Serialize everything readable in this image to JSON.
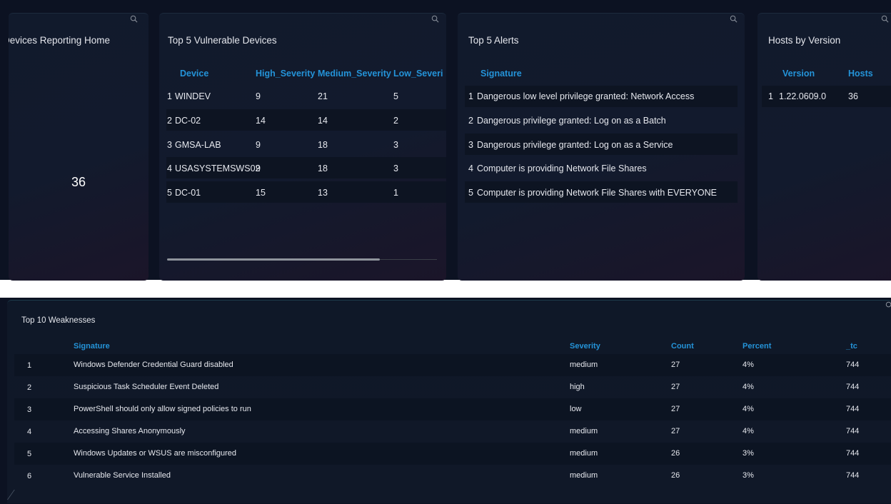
{
  "devices_reporting": {
    "title": "Devices Reporting Home",
    "value": "36"
  },
  "vulnerable_devices": {
    "title": "Top 5 Vulnerable Devices",
    "columns": [
      "Device",
      "High_Severity",
      "Medium_Severity",
      "Low_Severi"
    ],
    "rows": [
      {
        "rank": "1",
        "device": "WINDEV",
        "high": "9",
        "medium": "21",
        "low": "5"
      },
      {
        "rank": "2",
        "device": "DC-02",
        "high": "14",
        "medium": "14",
        "low": "2"
      },
      {
        "rank": "3",
        "device": "GMSA-LAB",
        "high": "9",
        "medium": "18",
        "low": "3"
      },
      {
        "rank": "4",
        "device": "USASYSTEMSWS02",
        "high": "9",
        "medium": "18",
        "low": "3"
      },
      {
        "rank": "5",
        "device": "DC-01",
        "high": "15",
        "medium": "13",
        "low": "1"
      }
    ]
  },
  "alerts": {
    "title": "Top 5 Alerts",
    "column": "Signature",
    "rows": [
      {
        "rank": "1",
        "signature": "Dangerous low level privilege granted: Network Access"
      },
      {
        "rank": "2",
        "signature": "Dangerous privilege granted: Log on as a Batch"
      },
      {
        "rank": "3",
        "signature": "Dangerous privilege granted: Log on as a Service"
      },
      {
        "rank": "4",
        "signature": "Computer is providing Network File Shares"
      },
      {
        "rank": "5",
        "signature": "Computer is providing Network File Shares with EVERYONE"
      }
    ]
  },
  "hosts_by_version": {
    "title": "Hosts by Version",
    "columns": [
      "Version",
      "Hosts"
    ],
    "rows": [
      {
        "rank": "1",
        "version": "1.22.0609.0",
        "hosts": "36"
      }
    ]
  },
  "weaknesses": {
    "title": "Top 10 Weaknesses",
    "columns": [
      "Signature",
      "Severity",
      "Count",
      "Percent",
      "_tc"
    ],
    "rows": [
      {
        "rank": "1",
        "signature": "Windows Defender Credential Guard disabled",
        "severity": "medium",
        "count": "27",
        "percent": "4%",
        "tc": "744"
      },
      {
        "rank": "2",
        "signature": "Suspicious Task Scheduler Event Deleted",
        "severity": "high",
        "count": "27",
        "percent": "4%",
        "tc": "744"
      },
      {
        "rank": "3",
        "signature": "PowerShell should only allow signed policies to run",
        "severity": "low",
        "count": "27",
        "percent": "4%",
        "tc": "744"
      },
      {
        "rank": "4",
        "signature": "Accessing Shares Anonymously",
        "severity": "medium",
        "count": "27",
        "percent": "4%",
        "tc": "744"
      },
      {
        "rank": "5",
        "signature": "Windows Updates or WSUS are misconfigured",
        "severity": "medium",
        "count": "26",
        "percent": "3%",
        "tc": "744"
      },
      {
        "rank": "6",
        "signature": "Vulnerable Service Installed",
        "severity": "medium",
        "count": "26",
        "percent": "3%",
        "tc": "744"
      }
    ]
  },
  "colors": {
    "background": "#0c1222",
    "panel": "#121a2d",
    "header_text": "#2493d8",
    "text": "#e6e8ee"
  },
  "icons": {
    "panel_search": "search-icon"
  }
}
